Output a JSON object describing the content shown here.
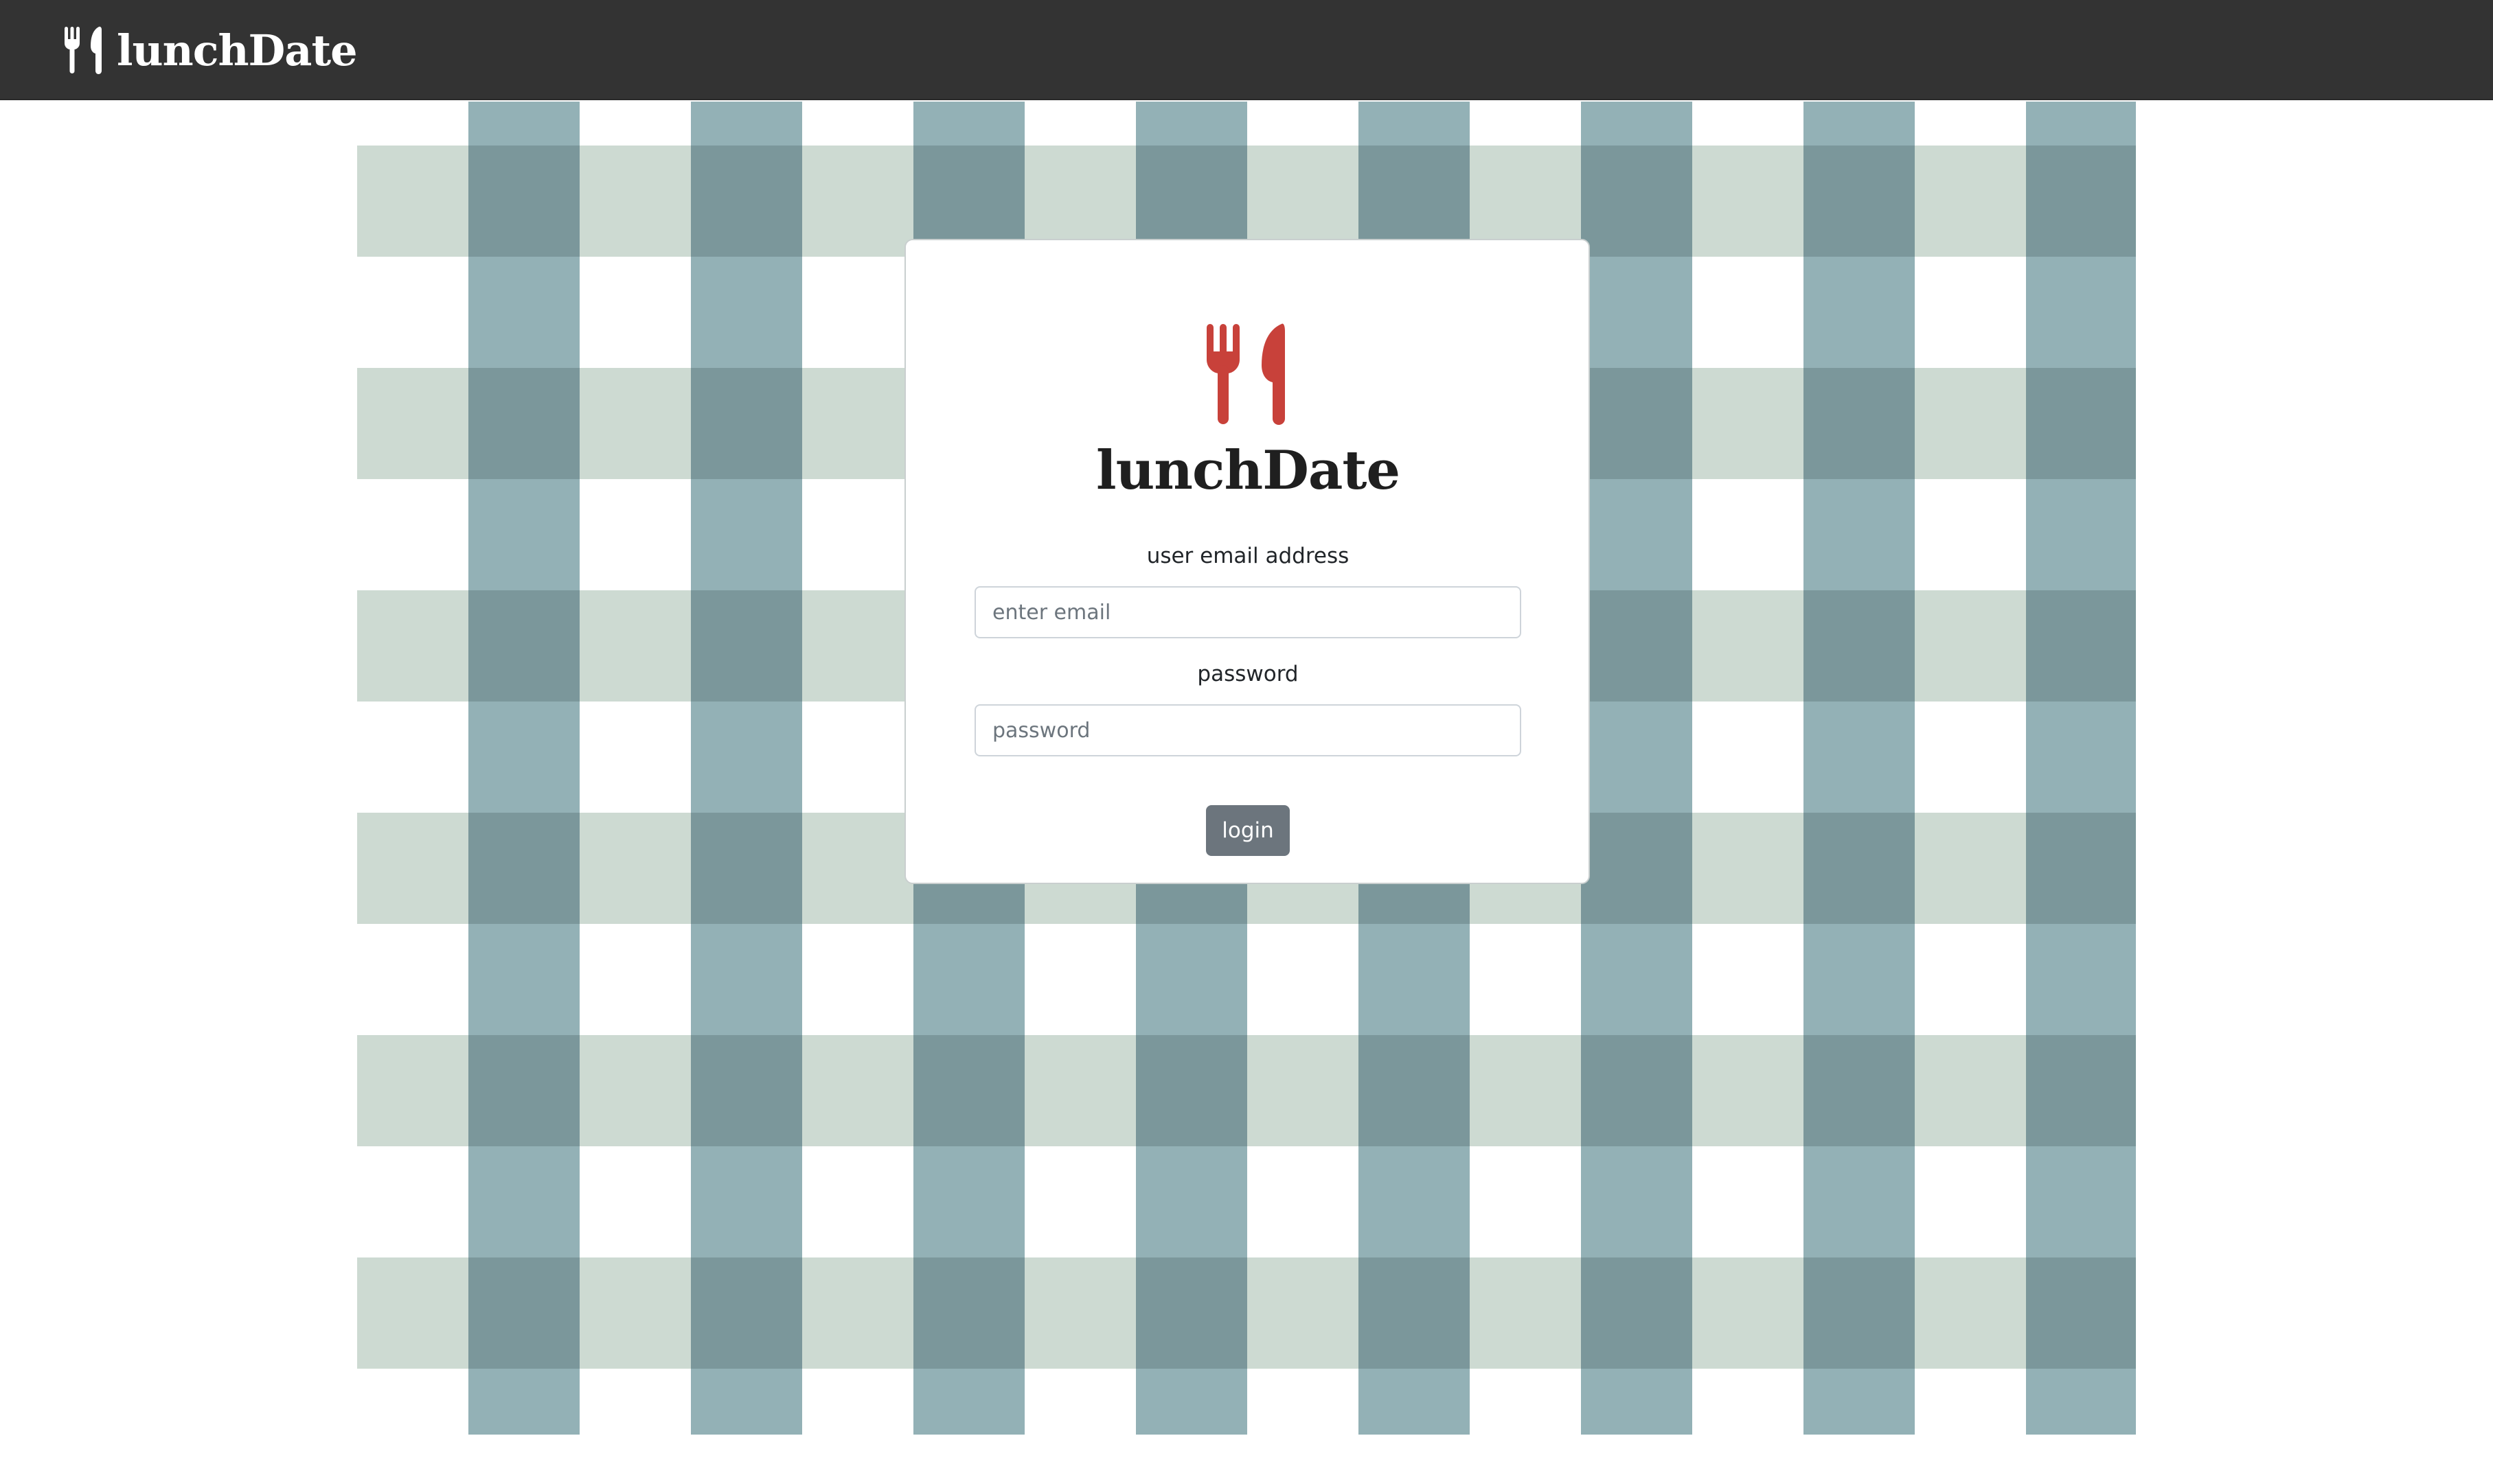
{
  "navbar": {
    "brand_icon": "fork-knife-icon",
    "brand_text": "lunchDate",
    "background": "#333333"
  },
  "background": {
    "pattern": "gingham",
    "colors": {
      "light_band": "#cddad2",
      "vertical_band": "#93b1b6",
      "intersection": "#7b979b",
      "base": "#ffffff"
    }
  },
  "login_card": {
    "logo_icon": "fork-knife-icon",
    "logo_color": "#c8413a",
    "title": "lunchDate",
    "email": {
      "label": "user email address",
      "placeholder": "enter email",
      "value": ""
    },
    "password": {
      "label": "password",
      "placeholder": "password",
      "value": ""
    },
    "login_button": {
      "label": "login",
      "color": "#6c757d"
    }
  }
}
